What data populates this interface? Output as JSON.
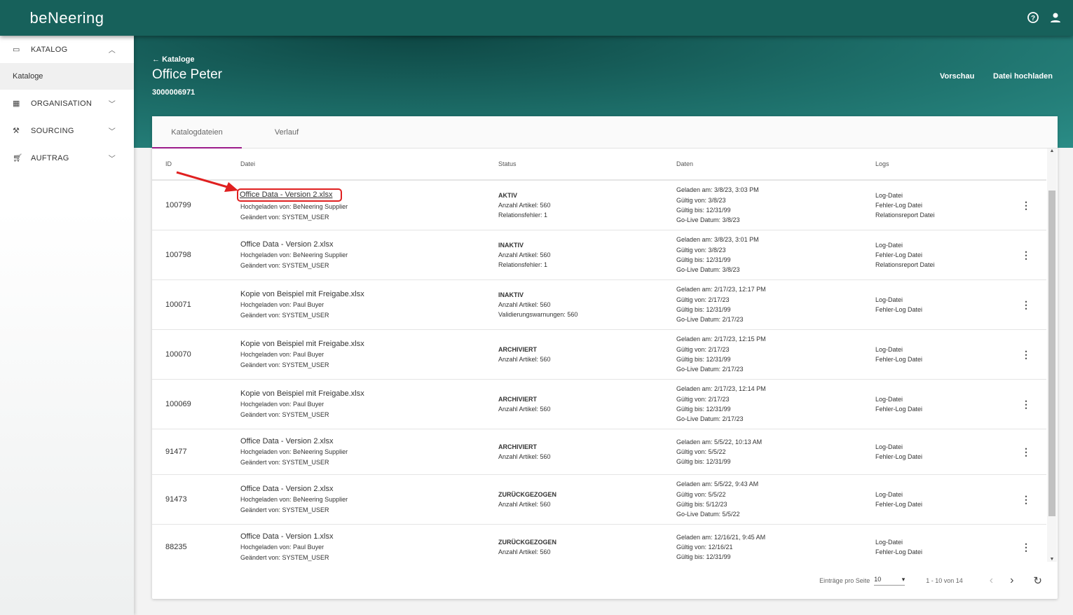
{
  "app": {
    "logo": "beNeering"
  },
  "sidebar": {
    "items": [
      {
        "label": "KATALOG",
        "icon": "folder-icon",
        "expanded": true,
        "sub": [
          {
            "label": "Kataloge"
          }
        ]
      },
      {
        "label": "ORGANISATION",
        "icon": "organisation-icon"
      },
      {
        "label": "SOURCING",
        "icon": "gavel-icon"
      },
      {
        "label": "AUFTRAG",
        "icon": "cart-icon"
      }
    ]
  },
  "header": {
    "back": "Kataloge",
    "title": "Office Peter",
    "id": "3000006971",
    "preview": "Vorschau",
    "upload": "Datei hochladen"
  },
  "tabs": [
    "Katalogdateien",
    "Verlauf"
  ],
  "table": {
    "headers": {
      "id": "ID",
      "file": "Datei",
      "status": "Status",
      "data": "Daten",
      "logs": "Logs"
    },
    "rows": [
      {
        "id": "100799",
        "file": "Office Data - Version 2.xlsx",
        "up": "Hochgeladen von: BeNeering Supplier",
        "ch": "Geändert von: SYSTEM_USER",
        "status": "AKTIV",
        "s1": "Anzahl Artikel: 560",
        "s2": "Relationsfehler: 1",
        "d": [
          "Geladen am: 3/8/23, 3:03 PM",
          "Gültig von: 3/8/23",
          "Gültig bis: 12/31/99",
          "Go-Live Datum: 3/8/23"
        ],
        "logs": [
          "Log-Datei",
          "Fehler-Log Datei",
          "Relationsreport Datei"
        ]
      },
      {
        "id": "100798",
        "file": "Office Data - Version 2.xlsx",
        "up": "Hochgeladen von: BeNeering Supplier",
        "ch": "Geändert von: SYSTEM_USER",
        "status": "INAKTIV",
        "s1": "Anzahl Artikel: 560",
        "s2": "Relationsfehler: 1",
        "d": [
          "Geladen am: 3/8/23, 3:01 PM",
          "Gültig von: 3/8/23",
          "Gültig bis: 12/31/99",
          "Go-Live Datum: 3/8/23"
        ],
        "logs": [
          "Log-Datei",
          "Fehler-Log Datei",
          "Relationsreport Datei"
        ]
      },
      {
        "id": "100071",
        "file": "Kopie von Beispiel mit Freigabe.xlsx",
        "up": "Hochgeladen von: Paul Buyer",
        "ch": "Geändert von: SYSTEM_USER",
        "status": "INAKTIV",
        "s1": "Anzahl Artikel: 560",
        "s2": "Validierungswarnungen: 560",
        "d": [
          "Geladen am: 2/17/23, 12:17 PM",
          "Gültig von: 2/17/23",
          "Gültig bis: 12/31/99",
          "Go-Live Datum: 2/17/23"
        ],
        "logs": [
          "Log-Datei",
          "Fehler-Log Datei"
        ]
      },
      {
        "id": "100070",
        "file": "Kopie von Beispiel mit Freigabe.xlsx",
        "up": "Hochgeladen von: Paul Buyer",
        "ch": "Geändert von: SYSTEM_USER",
        "status": "ARCHIVIERT",
        "s1": "Anzahl Artikel: 560",
        "d": [
          "Geladen am: 2/17/23, 12:15 PM",
          "Gültig von: 2/17/23",
          "Gültig bis: 12/31/99",
          "Go-Live Datum: 2/17/23"
        ],
        "logs": [
          "Log-Datei",
          "Fehler-Log Datei"
        ]
      },
      {
        "id": "100069",
        "file": "Kopie von Beispiel mit Freigabe.xlsx",
        "up": "Hochgeladen von: Paul Buyer",
        "ch": "Geändert von: SYSTEM_USER",
        "status": "ARCHIVIERT",
        "s1": "Anzahl Artikel: 560",
        "d": [
          "Geladen am: 2/17/23, 12:14 PM",
          "Gültig von: 2/17/23",
          "Gültig bis: 12/31/99",
          "Go-Live Datum: 2/17/23"
        ],
        "logs": [
          "Log-Datei",
          "Fehler-Log Datei"
        ]
      },
      {
        "id": "91477",
        "file": "Office Data - Version 2.xlsx",
        "up": "Hochgeladen von: BeNeering Supplier",
        "ch": "Geändert von: SYSTEM_USER",
        "status": "ARCHIVIERT",
        "s1": "Anzahl Artikel: 560",
        "d": [
          "Geladen am: 5/5/22, 10:13 AM",
          "Gültig von: 5/5/22",
          "Gültig bis: 12/31/99"
        ],
        "logs": [
          "Log-Datei",
          "Fehler-Log Datei"
        ]
      },
      {
        "id": "91473",
        "file": "Office Data - Version 2.xlsx",
        "up": "Hochgeladen von: BeNeering Supplier",
        "ch": "Geändert von: SYSTEM_USER",
        "status": "ZURÜCKGEZOGEN",
        "s1": "Anzahl Artikel: 560",
        "d": [
          "Geladen am: 5/5/22, 9:43 AM",
          "Gültig von: 5/5/22",
          "Gültig bis: 5/12/23",
          "Go-Live Datum: 5/5/22"
        ],
        "logs": [
          "Log-Datei",
          "Fehler-Log Datei"
        ]
      },
      {
        "id": "88235",
        "file": "Office Data - Version 1.xlsx",
        "up": "Hochgeladen von: Paul Buyer",
        "ch": "Geändert von: SYSTEM_USER",
        "status": "ZURÜCKGEZOGEN",
        "s1": "Anzahl Artikel: 560",
        "d": [
          "Geladen am: 12/16/21, 9:45 AM",
          "Gültig von: 12/16/21",
          "Gültig bis: 12/31/99"
        ],
        "logs": [
          "Log-Datei",
          "Fehler-Log Datei"
        ]
      }
    ]
  },
  "pagination": {
    "label": "Einträge pro Seite",
    "per_page": "10",
    "range": "1 - 10 von 14"
  },
  "colors": {
    "brand": "#17615b",
    "tab_accent": "#9c1b8a",
    "highlight": "#e02020"
  }
}
